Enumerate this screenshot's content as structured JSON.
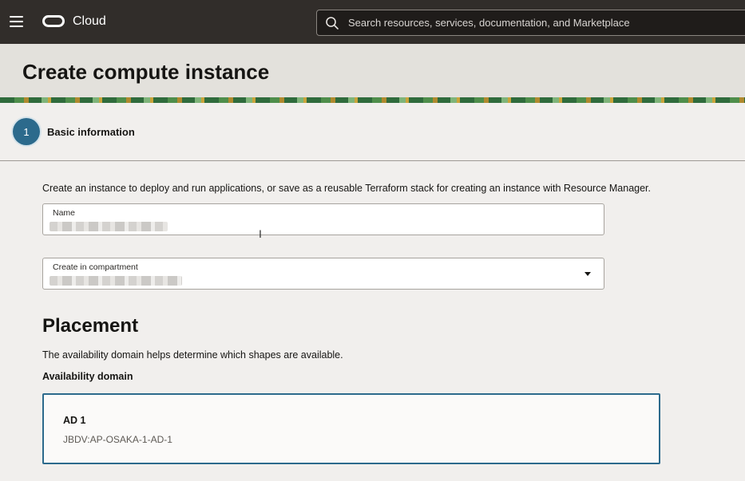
{
  "topbar": {
    "brand": "Cloud",
    "search_placeholder": "Search resources, services, documentation, and Marketplace"
  },
  "header": {
    "title": "Create compute instance"
  },
  "step": {
    "number": "1",
    "label": "Basic information"
  },
  "form": {
    "intro": "Create an instance to deploy and run applications, or save as a reusable Terraform stack for creating an instance with Resource Manager.",
    "name_label": "Name",
    "compartment_label": "Create in compartment"
  },
  "placement": {
    "title": "Placement",
    "description": "The availability domain helps determine which shapes are available.",
    "ad_label": "Availability domain",
    "ad_card": {
      "name": "AD 1",
      "id": "JBDV:AP-OSAKA-1-AD-1"
    }
  },
  "colors": {
    "topbar": "#312d2a",
    "accent": "#2c6a8c",
    "background": "#f1efed"
  }
}
